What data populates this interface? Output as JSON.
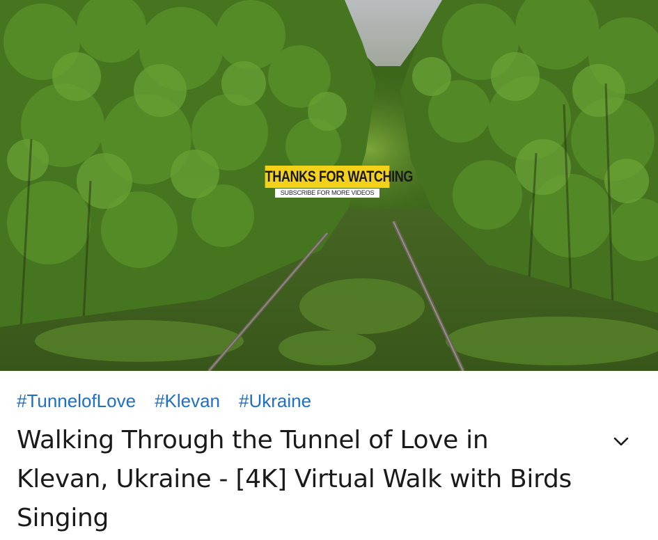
{
  "video": {
    "end_card": {
      "title": "THANKS FOR WATCHING",
      "subtitle": "SUBSCRIBE FOR MORE VIDEOS",
      "accent_color": "#f5d21a"
    }
  },
  "details": {
    "hashtags": [
      "#TunnelofLove",
      "#Klevan",
      "#Ukraine"
    ],
    "hashtag_color": "#1f6fc4",
    "title": "Walking Through the Tunnel of Love in Klevan, Ukraine - [4K] Virtual Walk with Birds Singing",
    "expand_icon": "chevron-down-icon"
  }
}
